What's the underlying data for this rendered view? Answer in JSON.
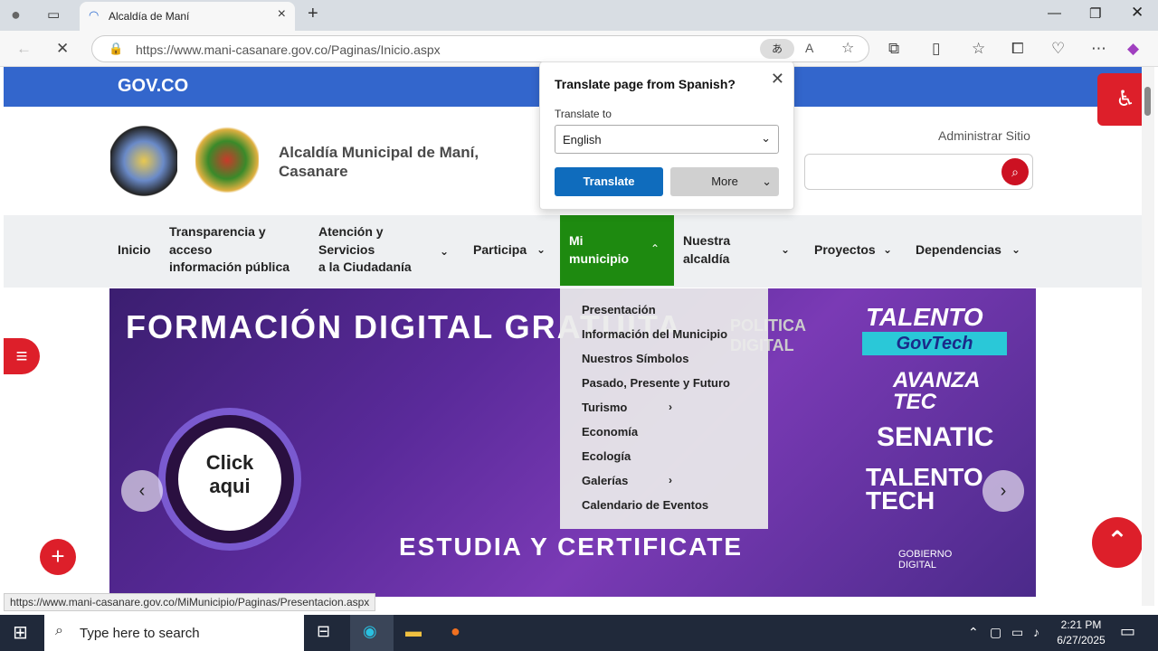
{
  "browser": {
    "tab_title": "Alcaldía de Maní",
    "url": "https://www.mani-casanare.gov.co/Paginas/Inicio.aspx",
    "status_url": "https://www.mani-casanare.gov.co/MiMunicipio/Paginas/Presentacion.aspx"
  },
  "translate_popup": {
    "title": "Translate page from Spanish?",
    "label": "Translate to",
    "selected_language": "English",
    "translate_button": "Translate",
    "more_button": "More"
  },
  "site": {
    "gov_logo": "GOV.CO",
    "title_line1": "Alcaldía Municipal de Maní,",
    "title_line2": "Casanare",
    "admin_link": "Administrar Sitio",
    "menu": [
      {
        "label1": "Inicio",
        "label2": "",
        "label3": ""
      },
      {
        "label1": "Transparencia y",
        "label2": "acceso",
        "label3": "información pública"
      },
      {
        "label1": "Atención y",
        "label2": "Servicios",
        "label3": "a la Ciudadanía"
      },
      {
        "label1": "Participa",
        "label2": "",
        "label3": ""
      },
      {
        "label1": "Mi",
        "label2": "municipio",
        "label3": ""
      },
      {
        "label1": "Nuestra",
        "label2": "alcaldía",
        "label3": ""
      },
      {
        "label1": "Proyectos",
        "label2": "",
        "label3": ""
      },
      {
        "label1": "Dependencias",
        "label2": "",
        "label3": ""
      }
    ],
    "dropdown": [
      "Presentación",
      "Información del Municipio",
      "Nuestros Símbolos",
      "Pasado, Presente y Futuro",
      "Turismo",
      "Economía",
      "Ecología",
      "Galerías",
      "Calendario de Eventos"
    ],
    "banner": {
      "headline": "FORMACIÓN DIGITAL GRATUITA",
      "subline": "ESTUDIA Y CERTIFICATE",
      "click_line1": "Click",
      "click_line2": "aqui",
      "overlay": "POLITICA DIGITAL",
      "brand1": "TALENTO",
      "brand1b": "GovTech",
      "brand2": "AVANZA TEC",
      "brand3": "SENATIC",
      "brand4": "TALENTO TECH",
      "gov_digital": "GOBIERNO DIGITAL"
    }
  },
  "taskbar": {
    "search_placeholder": "Type here to search",
    "time": "2:21 PM",
    "date": "6/27/2025"
  }
}
